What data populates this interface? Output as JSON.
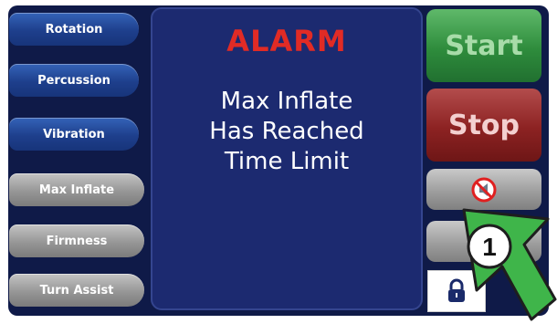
{
  "left_buttons": [
    {
      "label": "Rotation",
      "style": "blue"
    },
    {
      "label": "Percussion",
      "style": "blue"
    },
    {
      "label": "Vibration",
      "style": "blue"
    },
    {
      "label": "Max Inflate",
      "style": "gray"
    },
    {
      "label": "Firmness",
      "style": "gray"
    },
    {
      "label": "Turn Assist",
      "style": "gray"
    }
  ],
  "alarm": {
    "title": "ALARM",
    "message_lines": [
      "Max Inflate",
      "Has Reached",
      "Time Limit"
    ]
  },
  "right_buttons": {
    "start_label": "Start",
    "stop_label": "Stop",
    "mute_icon": "alarm-mute-icon",
    "lock_icon": "lock-icon"
  },
  "callout": {
    "number": "1",
    "icon": "pointing-arrow-icon"
  },
  "colors": {
    "alarm_red": "#e12b25",
    "panel_navy": "#1c2a70",
    "start_green": "#2e8c3c",
    "stop_red": "#8c2222",
    "callout_green": "#3fb54a"
  }
}
